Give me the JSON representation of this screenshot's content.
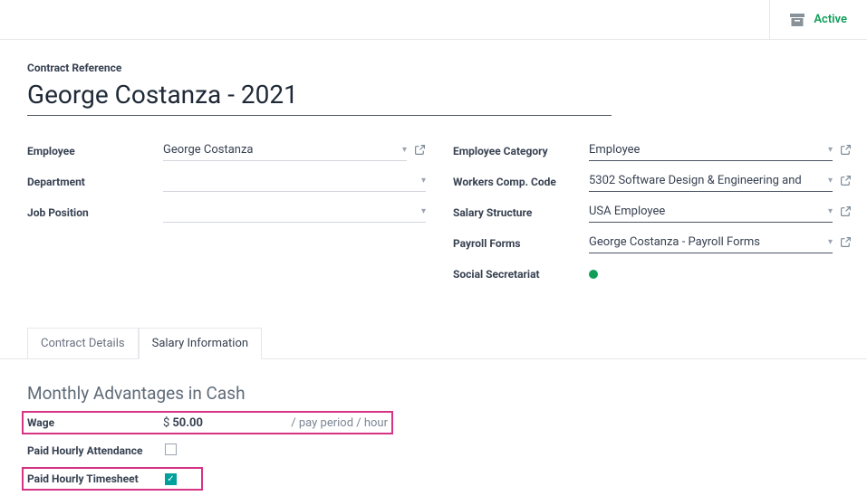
{
  "status": {
    "label": "Active"
  },
  "contract": {
    "ref_label": "Contract Reference",
    "title": "George Costanza - 2021"
  },
  "left_fields": {
    "employee": {
      "label": "Employee",
      "value": "George Costanza"
    },
    "department": {
      "label": "Department",
      "value": ""
    },
    "job_position": {
      "label": "Job Position",
      "value": ""
    }
  },
  "right_fields": {
    "category": {
      "label": "Employee Category",
      "value": "Employee"
    },
    "workers_comp": {
      "label": "Workers Comp. Code",
      "value": "5302 Software Design & Engineering and"
    },
    "salary_structure": {
      "label": "Salary Structure",
      "value": "USA Employee"
    },
    "payroll_forms": {
      "label": "Payroll Forms",
      "value": "George Costanza - Payroll Forms"
    },
    "social": {
      "label": "Social Secretariat"
    }
  },
  "tabs": {
    "contract_details": "Contract Details",
    "salary_info": "Salary Information"
  },
  "section": {
    "title": "Monthly Advantages in Cash",
    "wage_label": "Wage",
    "wage_currency": "$",
    "wage_value": "50.00",
    "wage_per": "/ pay period / hour",
    "paid_attendance_label": "Paid Hourly Attendance",
    "paid_timesheet_label": "Paid Hourly Timesheet"
  }
}
